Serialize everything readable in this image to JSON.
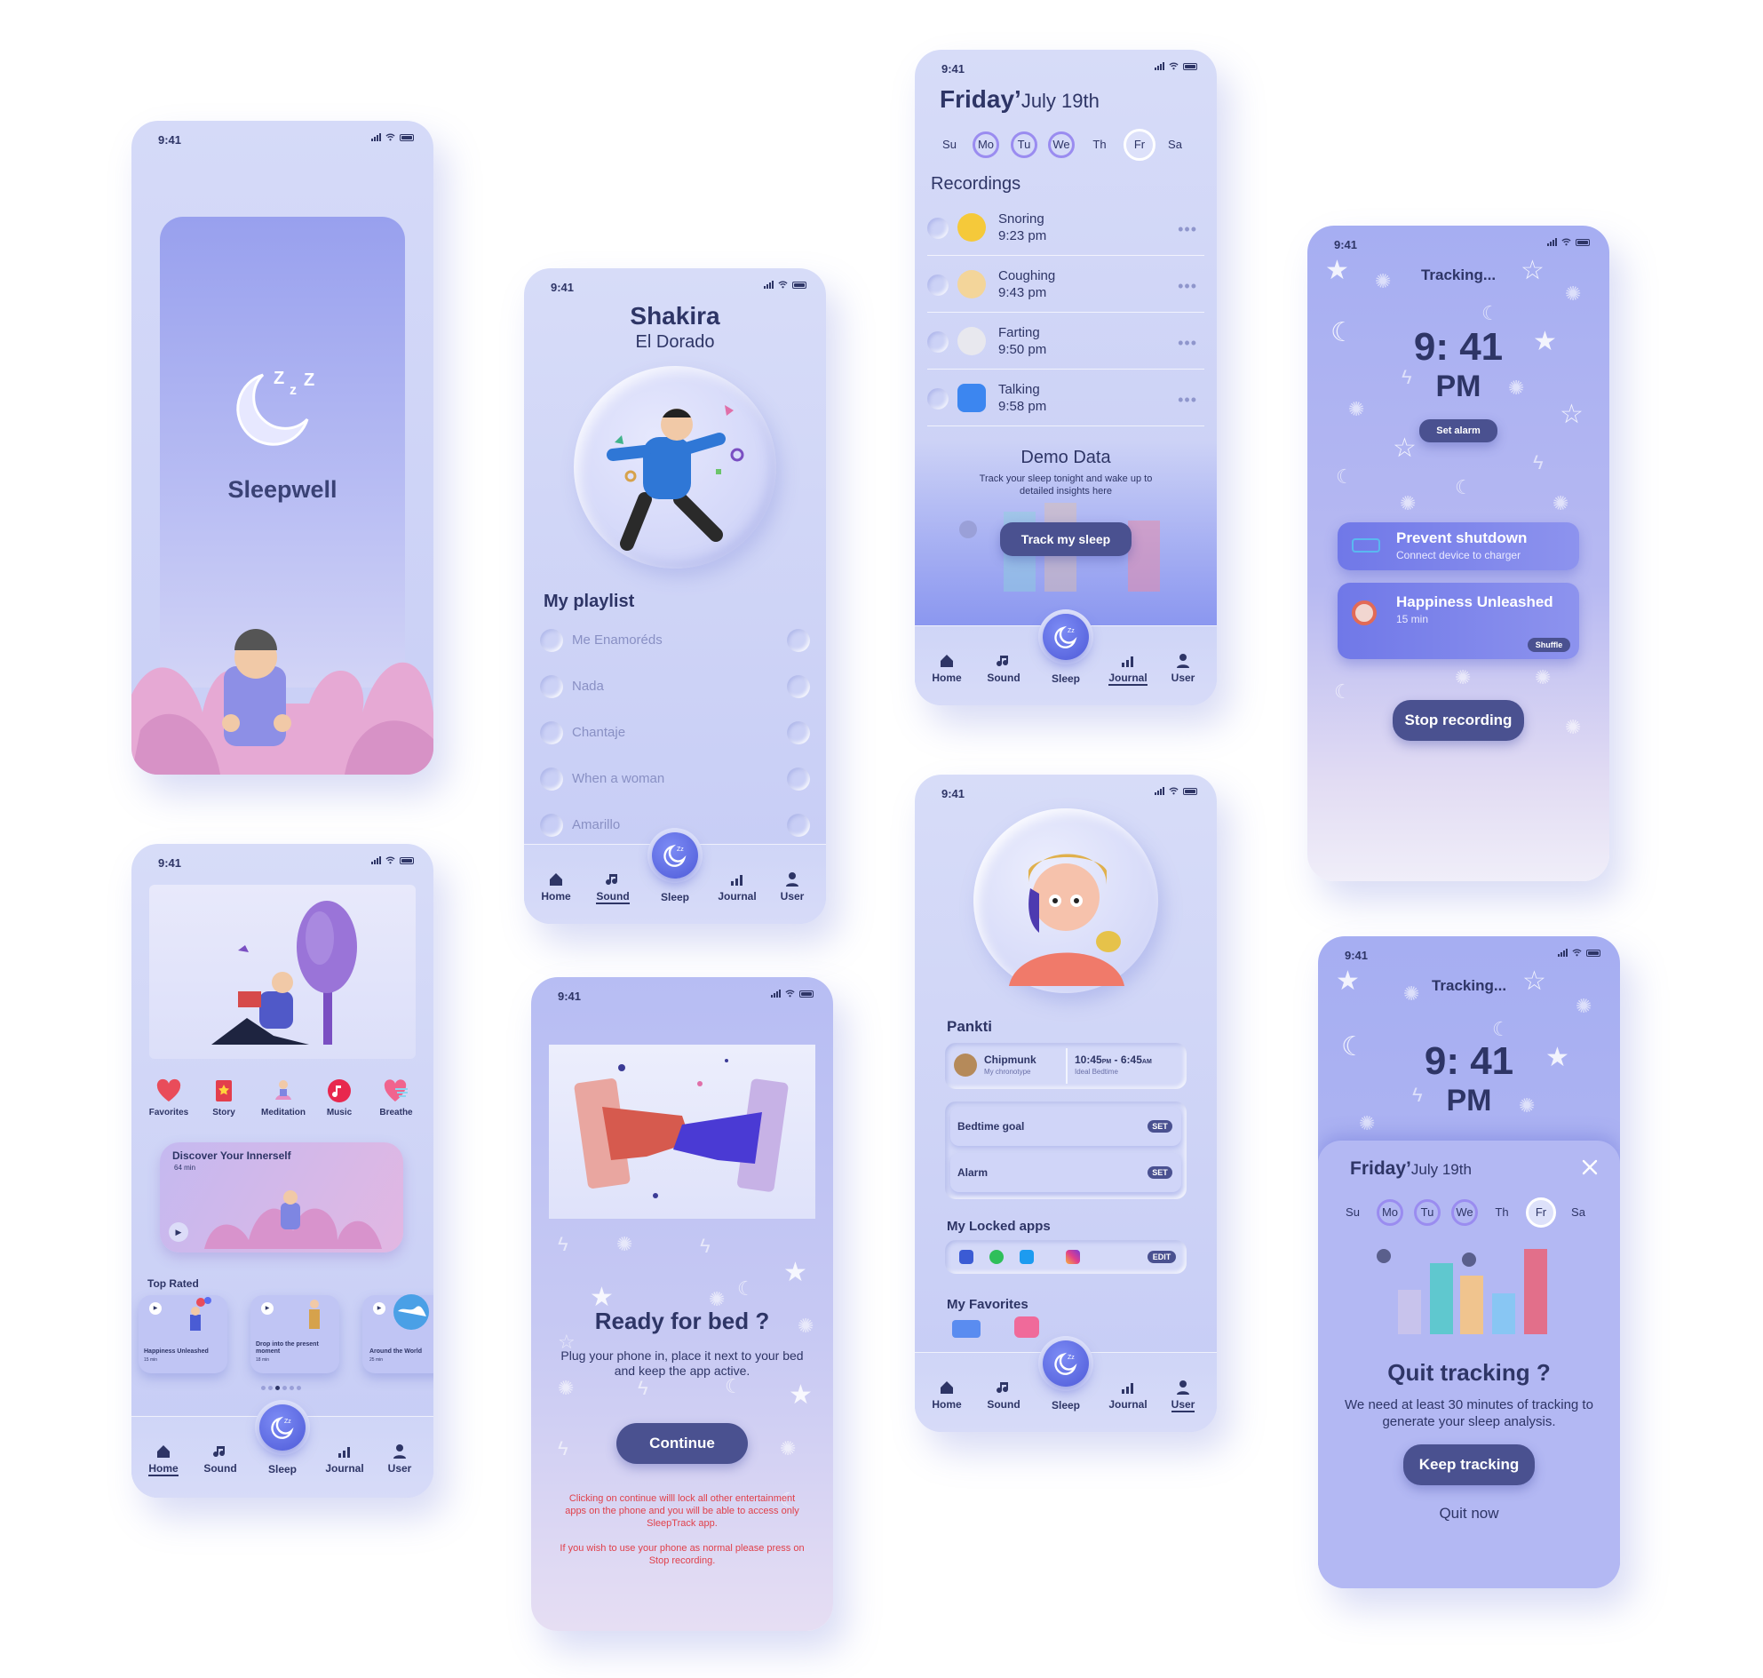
{
  "status_time": "9:41",
  "nav": {
    "home": "Home",
    "sound": "Sound",
    "sleep": "Sleep",
    "journal": "Journal",
    "user": "User"
  },
  "splash": {
    "app_name": "Sleepwell"
  },
  "home": {
    "categories": [
      "Favorites",
      "Story",
      "Meditation",
      "Music",
      "Breathe"
    ],
    "discover_title": "Discover Your Innerself",
    "discover_duration": "64 min",
    "top_rated_label": "Top Rated",
    "top_rated": [
      {
        "title": "Happiness Unleashed",
        "duration": "15 min"
      },
      {
        "title": "Drop into the present moment",
        "duration": "18 min"
      },
      {
        "title": "Around the World",
        "duration": "25 min"
      }
    ]
  },
  "player": {
    "artist": "Shakira",
    "song": "El Dorado",
    "playlist_title": "My playlist",
    "tracks": [
      "Me Enamoréds",
      "Nada",
      "Chantaje",
      "When a woman",
      "Amarillo"
    ]
  },
  "ready": {
    "title": "Ready for bed ?",
    "body": "Plug your phone in, place it next to your bed and keep the app active.",
    "continue_label": "Continue",
    "warning1": "Clicking on continue willl lock all other entertainment apps on the phone and you will be able to access only SleepTrack app.",
    "warning2": "If you wish to use your phone as normal please press on Stop recording.",
    "warning_color": "#e0404a"
  },
  "journal": {
    "day_name": "Friday’",
    "date": "July 19th",
    "weekdays": [
      "Su",
      "Mo",
      "Tu",
      "We",
      "Th",
      "Fr",
      "Sa"
    ],
    "recordings_label": "Recordings",
    "recordings": [
      {
        "name": "Snoring",
        "time": "9:23 pm"
      },
      {
        "name": "Coughing",
        "time": "9:43 pm"
      },
      {
        "name": "Farting",
        "time": "9:50 pm"
      },
      {
        "name": "Talking",
        "time": "9:58 pm"
      }
    ],
    "demo_title": "Demo Data",
    "demo_body": "Track your sleep tonight and wake up to detailed insights here",
    "track_label": "Track my sleep"
  },
  "profile": {
    "name": "Pankti",
    "chronotype_value": "Chipmunk",
    "chronotype_label": "My chronotype",
    "bedtime_start": "10:45",
    "bedtime_start_suffix": "PM",
    "bedtime_sep": " - ",
    "bedtime_end": "6:45",
    "bedtime_end_suffix": "AM",
    "bedtime_label": "Ideal Bedtime",
    "bedtime_goal": "Bedtime goal",
    "alarm": "Alarm",
    "set_label": "SET",
    "locked_apps_label": "My Locked apps",
    "edit_label": "EDIT",
    "favorites_label": "My Favorites"
  },
  "tracking": {
    "title": "Tracking...",
    "hour": "9",
    "colon": ":",
    "minute": " 41",
    "ampm": "PM",
    "set_alarm": "Set alarm",
    "prevent_title": "Prevent shutdown",
    "prevent_sub": "Connect device to charger",
    "track_title": "Happiness Unleashed",
    "track_duration": "15 min",
    "shuffle": "Shuffle",
    "stop_label": "Stop recording"
  },
  "quit": {
    "title": "Quit tracking ?",
    "body": "We need at least 30 minutes of tracking to generate your sleep analysis.",
    "keep_label": "Keep tracking",
    "quit_label": "Quit now",
    "close_icon": "close-icon"
  }
}
